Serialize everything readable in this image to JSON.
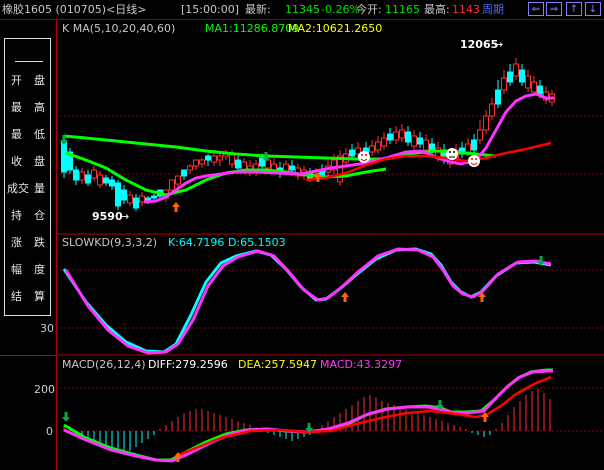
{
  "toolbar": {
    "symbol": "橡胶1605 (010705)",
    "period": "<日线>",
    "time": "[15:00:00]",
    "latest_label": "最新:",
    "latest_value": "11345",
    "change_pct": "-0.26%",
    "open_label": "今开:",
    "open_value": "11165",
    "high_label": "最高:",
    "high_value": "1143",
    "cycle_label": "周期",
    "nav_buttons": [
      "⇐",
      "⇒",
      "↑",
      "↓"
    ]
  },
  "side_menu": {
    "rows": [
      [
        "开",
        "盘"
      ],
      [
        "最",
        "高"
      ],
      [
        "最",
        "低"
      ],
      [
        "收",
        "盘"
      ],
      [
        "成交",
        "量"
      ],
      [
        "持",
        "仓"
      ],
      [
        "涨",
        "跌"
      ],
      [
        "幅",
        "度"
      ],
      [
        "结",
        "算"
      ]
    ]
  },
  "main_panel": {
    "title": "K  MA(5,10,20,40,60)",
    "ma1": "MA1:11286.8709",
    "ma2": "MA2:10621.2650",
    "high_marker": "12065",
    "low_marker": "9590"
  },
  "kd_panel": {
    "title": "SLOWKD(9,3,3,2)",
    "k": "K:64.7196",
    "d": "D:65.1503",
    "axis_label": "30"
  },
  "macd_panel": {
    "title": "MACD(26,12,4)",
    "diff": "DIFF:279.2596",
    "dea": "DEA:257.5947",
    "macd": "MACD:43.3297",
    "axis_200": "200",
    "axis_0": "0"
  },
  "colors": {
    "up": "#ff3030",
    "down": "#00ffff",
    "ma_slow": "#00ff00",
    "ma_pink": "#ff33ff",
    "kd_k": "#00ffff",
    "grid": "#8a0000"
  }
}
